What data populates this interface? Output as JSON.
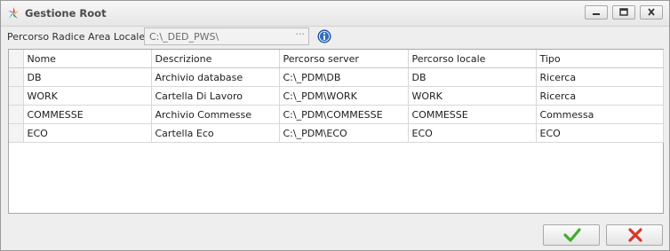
{
  "window": {
    "title": "Gestione Root",
    "icons": {
      "app": "colorful-star-icon",
      "minimize": "minimize-icon",
      "maximize": "maximize-icon",
      "close": "close-icon"
    }
  },
  "path_field": {
    "label": "Percorso Radice Area Locale",
    "value": "C:\\_DED_PWS\\",
    "ellipsis": "···",
    "info_icon": "info-icon"
  },
  "grid": {
    "columns": [
      "",
      "Nome",
      "Descrizione",
      "Percorso server",
      "Percorso locale",
      "Tipo"
    ],
    "rows": [
      [
        "",
        "DB",
        "Archivio database",
        "C:\\_PDM\\DB",
        "DB",
        "Ricerca"
      ],
      [
        "",
        "WORK",
        "Cartella Di Lavoro",
        "C:\\_PDM\\WORK",
        "WORK",
        "Ricerca"
      ],
      [
        "",
        "COMMESSE",
        "Archivio Commesse",
        "C:\\_PDM\\COMMESSE",
        "COMMESSE",
        "Commessa"
      ],
      [
        "",
        "ECO",
        "Cartella Eco",
        "C:\\_PDM\\ECO",
        "ECO",
        "ECO"
      ]
    ]
  },
  "buttons": {
    "ok_icon": "green-checkmark-icon",
    "cancel_icon": "red-x-icon"
  },
  "colors": {
    "ok_green": "#3fae2a",
    "cancel_red": "#d9362b",
    "info_blue": "#2f6fc4"
  }
}
